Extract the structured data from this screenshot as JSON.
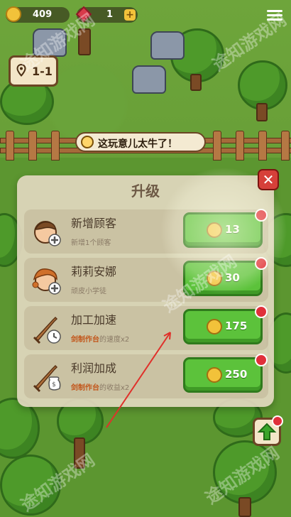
{
  "hud": {
    "coins": "409",
    "gems": "1",
    "level": "1-1"
  },
  "speech": {
    "text": "这玩意儿太牛了！"
  },
  "upgrade_panel": {
    "title": "升级",
    "items": [
      {
        "name": "新增顾客",
        "desc_plain": "新增1个顾客",
        "desc_highlight": "",
        "price": "13"
      },
      {
        "name": "莉莉安娜",
        "desc_plain": "顽皮小学徒",
        "desc_highlight": "",
        "price": "30"
      },
      {
        "name": "加工加速",
        "desc_highlight": "剑制作台",
        "desc_plain": "的速度x2",
        "price": "175"
      },
      {
        "name": "利润加成",
        "desc_highlight": "剑制作台",
        "desc_plain": "的收益x2",
        "price": "250"
      }
    ]
  },
  "watermark": {
    "text": "途知游戏网"
  },
  "colors": {
    "buy_green": "#5cc23b",
    "close_red": "#d6403a",
    "highlight_orange": "#c2571c"
  }
}
